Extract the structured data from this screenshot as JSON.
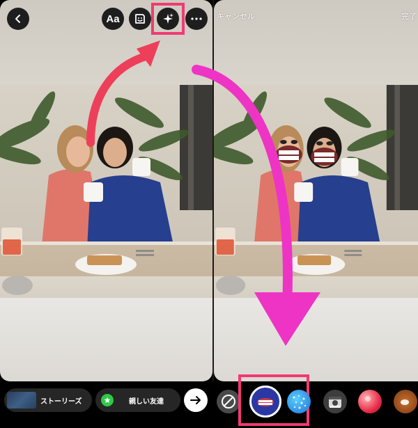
{
  "left_toolbar": {
    "back_icon": "chevron-left-icon",
    "text_button_label": "Aa",
    "sticker_icon": "sticker-icon",
    "effects_icon": "sparkles-icon",
    "more_icon": "more-horizontal-icon"
  },
  "right_header": {
    "cancel_label": "キャンセル",
    "done_label": "完了"
  },
  "share_bar": {
    "stories_label": "ストーリーズ",
    "close_friends_label": "親しい友達",
    "close_friends_icon": "star-icon",
    "send_icon": "arrow-right-icon"
  },
  "effects_tray": {
    "none_icon": "no-effect-icon",
    "items": [
      "mouth-mask-effect",
      "sparkle-filter-effect",
      "camera-effect",
      "red-bubble-effect",
      "donut-effect"
    ]
  },
  "colors": {
    "highlight_red": "#f03a72",
    "arrow_red": "#ee3f5a",
    "arrow_magenta": "#ee34c4",
    "close_friends_green": "#2ec948"
  }
}
